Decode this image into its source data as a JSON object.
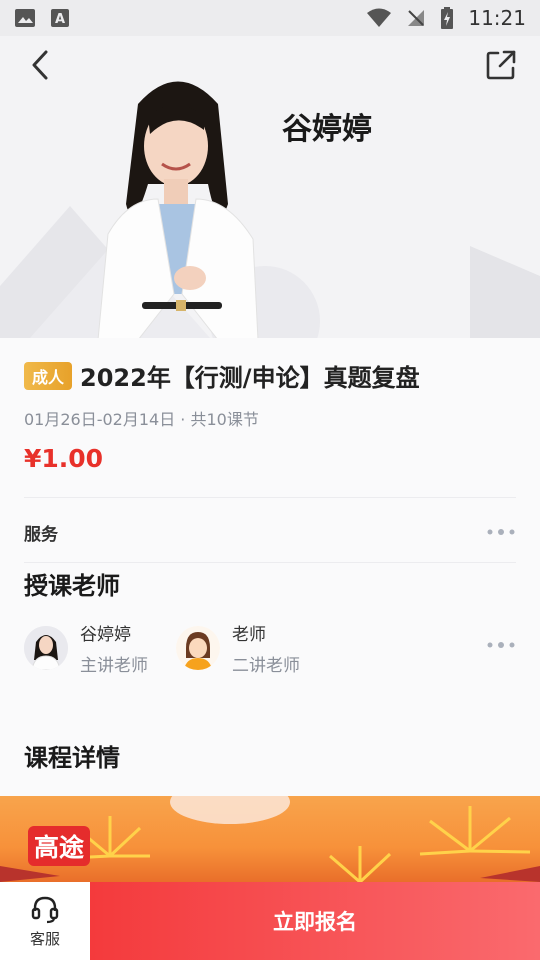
{
  "status_bar": {
    "time": "11:21",
    "left_icons": [
      "gallery-icon",
      "font-icon"
    ],
    "right_icons": [
      "wifi-icon",
      "no-signal-icon",
      "battery-charging-icon"
    ]
  },
  "header": {
    "teacher_name": "谷婷婷",
    "back_icon": "chevron-left-icon",
    "share_icon": "share-icon"
  },
  "course": {
    "tag": "成人",
    "title": "2022年【行测/申论】真题复盘",
    "dates": "01月26日-02月14日 · 共10课节",
    "price": "¥1.00"
  },
  "service": {
    "label": "服务"
  },
  "teachers_section": {
    "title": "授课老师",
    "teachers": [
      {
        "name": "谷婷婷",
        "role": "主讲老师"
      },
      {
        "name": "老师",
        "role": "二讲老师"
      }
    ]
  },
  "details_section": {
    "title": "课程详情"
  },
  "banner": {
    "logo_text": "高途"
  },
  "bottom_bar": {
    "customer_service_label": "客服",
    "enroll_label": "立即报名"
  },
  "colors": {
    "price_red": "#e8312a",
    "tag_orange": "#e7a12a",
    "enroll_red": "#f43a3c"
  }
}
